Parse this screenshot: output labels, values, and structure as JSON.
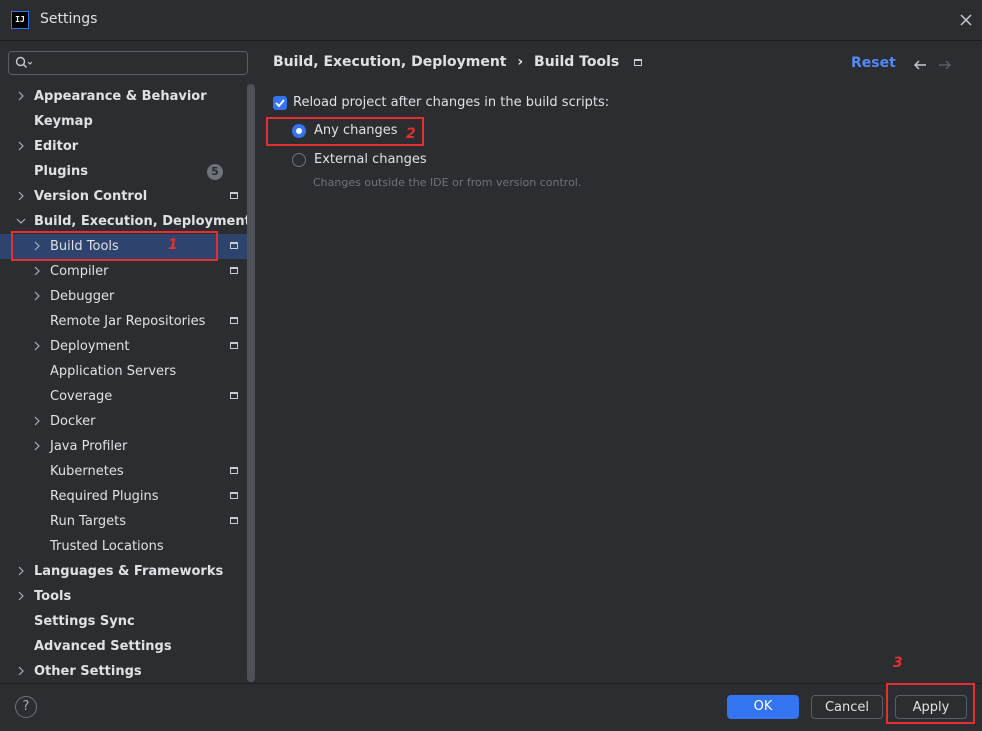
{
  "window": {
    "title": "Settings",
    "logo_text": "IJ"
  },
  "search": {
    "placeholder": "",
    "value": ""
  },
  "sidebar": {
    "items": [
      {
        "label": "Appearance & Behavior",
        "chevron": "right",
        "bold": true
      },
      {
        "label": "Keymap",
        "chevron": "none",
        "bold": true
      },
      {
        "label": "Editor",
        "chevron": "right",
        "bold": true
      },
      {
        "label": "Plugins",
        "chevron": "none",
        "bold": true,
        "badge": "5"
      },
      {
        "label": "Version Control",
        "chevron": "right",
        "bold": true,
        "pinned": true
      },
      {
        "label": "Build, Execution, Deployment",
        "chevron": "down",
        "bold": true
      },
      {
        "label": "Build Tools",
        "chevron": "right",
        "bold": false,
        "pinned": true,
        "selected": true
      },
      {
        "label": "Compiler",
        "chevron": "right",
        "bold": false,
        "pinned": true
      },
      {
        "label": "Debugger",
        "chevron": "right",
        "bold": false
      },
      {
        "label": "Remote Jar Repositories",
        "chevron": "none",
        "bold": false,
        "pinned": true
      },
      {
        "label": "Deployment",
        "chevron": "right",
        "bold": false,
        "pinned": true
      },
      {
        "label": "Application Servers",
        "chevron": "none",
        "bold": false
      },
      {
        "label": "Coverage",
        "chevron": "none",
        "bold": false,
        "pinned": true
      },
      {
        "label": "Docker",
        "chevron": "right",
        "bold": false
      },
      {
        "label": "Java Profiler",
        "chevron": "right",
        "bold": false
      },
      {
        "label": "Kubernetes",
        "chevron": "none",
        "bold": false,
        "pinned": true
      },
      {
        "label": "Required Plugins",
        "chevron": "none",
        "bold": false,
        "pinned": true
      },
      {
        "label": "Run Targets",
        "chevron": "none",
        "bold": false,
        "pinned": true
      },
      {
        "label": "Trusted Locations",
        "chevron": "none",
        "bold": false
      },
      {
        "label": "Languages & Frameworks",
        "chevron": "right",
        "bold": true
      },
      {
        "label": "Tools",
        "chevron": "right",
        "bold": true
      },
      {
        "label": "Settings Sync",
        "chevron": "none",
        "bold": true
      },
      {
        "label": "Advanced Settings",
        "chevron": "none",
        "bold": true
      },
      {
        "label": "Other Settings",
        "chevron": "right",
        "bold": true
      }
    ]
  },
  "breadcrumb": {
    "parent": "Build, Execution, Deployment",
    "separator": "›",
    "current": "Build Tools"
  },
  "header": {
    "reset_label": "Reset",
    "back_icon": "arrow-left-icon",
    "forward_icon": "arrow-right-icon"
  },
  "content": {
    "reload_checkbox": {
      "label": "Reload project after changes in the build scripts:",
      "checked": true
    },
    "options": [
      {
        "label": "Any changes",
        "selected": true
      },
      {
        "label": "External changes",
        "selected": false
      }
    ],
    "hint": "Changes outside the IDE or from version control."
  },
  "annotations": {
    "marker_1": "1",
    "marker_2": "2",
    "marker_3": "3",
    "color": "#e32f2f"
  },
  "footer": {
    "ok_label": "OK",
    "cancel_label": "Cancel",
    "apply_label": "Apply",
    "help_label": "?"
  },
  "colors": {
    "accent": "#3574f0",
    "link": "#548af7",
    "selection": "#2e436e",
    "background": "#2b2d30"
  }
}
